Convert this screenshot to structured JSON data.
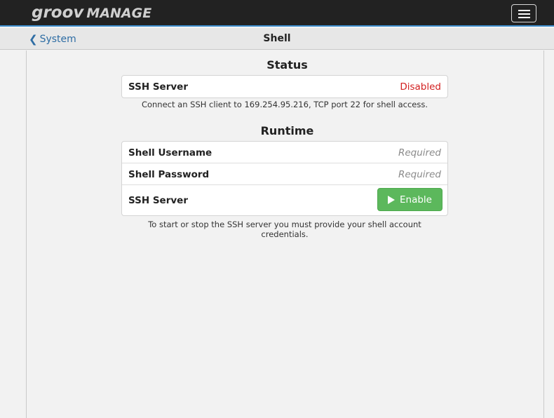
{
  "app": {
    "brand_part1": "groov",
    "brand_part2": "MANAGE"
  },
  "nav": {
    "back_label": "System",
    "title": "Shell"
  },
  "status": {
    "heading": "Status",
    "rows": [
      {
        "label": "SSH Server",
        "value": "Disabled"
      }
    ],
    "help": "Connect an SSH client to 169.254.95.216, TCP port 22 for shell access."
  },
  "runtime": {
    "heading": "Runtime",
    "username_label": "Shell Username",
    "username_placeholder": "Required",
    "password_label": "Shell Password",
    "password_placeholder": "Required",
    "ssh_label": "SSH Server",
    "enable_label": "Enable",
    "help": "To start or stop the SSH server you must provide your shell account credentials."
  },
  "colors": {
    "topbar": "#222222",
    "accent": "#3f8fcf",
    "link": "#2e6da4",
    "disabled": "#d21f1f",
    "enable": "#5cb85c"
  },
  "icons": {
    "back": "chevron-left-icon",
    "menu": "hamburger-menu-icon",
    "enable": "play-icon"
  }
}
